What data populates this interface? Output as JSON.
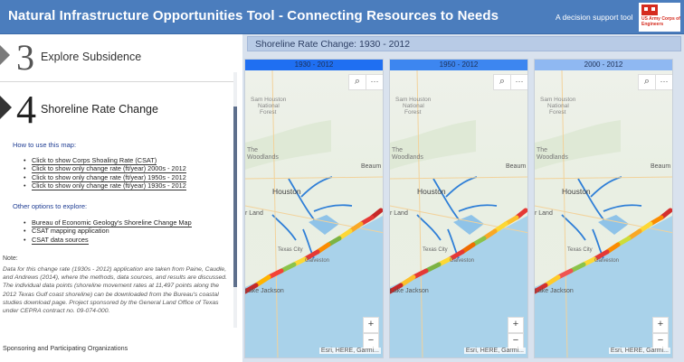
{
  "header": {
    "title": "Natural Infrastructure Opportunities Tool - Connecting Resources to Needs",
    "subtitle": "A decision support tool",
    "logo_text": "US Army Corps of Engineers"
  },
  "sidebar": {
    "steps": [
      {
        "number": "3",
        "label": "Explore Subsidence"
      },
      {
        "number": "4",
        "label": "Shoreline Rate Change"
      }
    ],
    "how_to_heading": "How to use this map:",
    "how_to_items": [
      "Click to show Corps Shoaling Rate (CSAT)",
      "Click to show only change rate (ft/year) 2000s - 2012",
      "Click to show only change rate (ft/year) 1950s - 2012",
      "Click to show only change rate (ft/year) 1930s - 2012"
    ],
    "other_heading": "Other options to explore:",
    "other_items": [
      "Bureau of Economic Geology's Shoreline Change Map",
      "CSAT mapping application",
      "CSAT data sources"
    ],
    "note_title": "Note:",
    "note_body": "Data for this change rate (1930s - 2012) application are taken from Paine, Caudle, and Andrews (2014), where the methods, data sources, and results are discussed. The individual data points (shoreline movement rates at 11,497 points along the 2012 Texas Gulf coast shoreline) can be downloaded from the Bureau's coastal studies download page. Project sponsored by the General Land Office of Texas under CEPRA contract no. 09-074-000.",
    "sponsor": "Sponsoring and Participating Organizations"
  },
  "panel": {
    "title": "Shoreline Rate Change: 1930 - 2012",
    "maps": [
      {
        "tab": "1930 - 2012",
        "tab_color": "#1f6ff2"
      },
      {
        "tab": "1950 - 2012",
        "tab_color": "#3d86f0"
      },
      {
        "tab": "2000 - 2012",
        "tab_color": "#8fb8f2"
      }
    ],
    "map_labels": {
      "forest": "Sam Houston National Forest",
      "woodlands": "The Woodlands",
      "beaumont": "Beaum",
      "houston": "Houston",
      "land": "r Land",
      "texas_city": "Texas City",
      "galveston": "Galveston",
      "lake_jackson": "Lake Jackson"
    },
    "attribution": "Esri, HERE, Garmi...",
    "zoom_in": "+",
    "zoom_out": "−",
    "search_symbol": "⌕",
    "more_symbol": "···"
  }
}
